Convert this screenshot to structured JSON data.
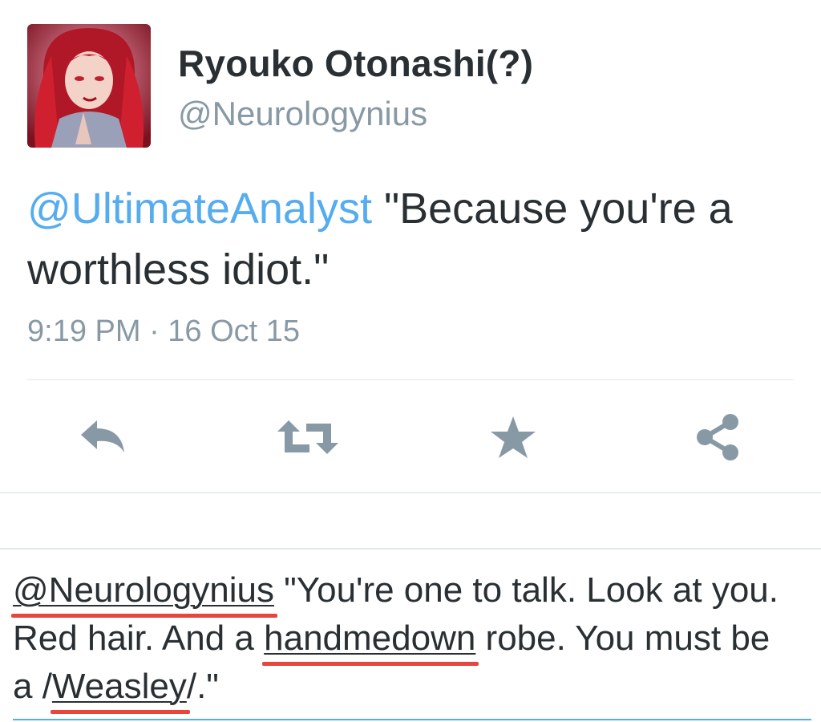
{
  "tweet": {
    "display_name": "Ryouko Otonashi(?)",
    "handle": "@Neurologynius",
    "mention": "@UltimateAnalyst",
    "text_part1": " \"Because you're a",
    "text_part2": "worthless idiot.\"",
    "timestamp": "9:19 PM · 16 Oct 15",
    "avatar_icon": "red-haired-anime-avatar"
  },
  "actions": [
    {
      "name": "reply",
      "icon": "reply-icon"
    },
    {
      "name": "retweet",
      "icon": "retweet-icon"
    },
    {
      "name": "favorite",
      "icon": "star-icon"
    },
    {
      "name": "share",
      "icon": "share-icon"
    }
  ],
  "reply_draft": {
    "mention": "@Neurologynius",
    "seg1": " \"You're one to talk. Look at you.",
    "seg2": "Red hair. And a ",
    "word_handmedown": "handmedown",
    "seg3": " robe. You must be",
    "seg4": "a /",
    "word_weasley": "Weasley",
    "seg5": "/.\""
  },
  "colors": {
    "text": "#292f33",
    "muted": "#8899a6",
    "link": "#55acee",
    "spellcheck": "#e8453c"
  }
}
